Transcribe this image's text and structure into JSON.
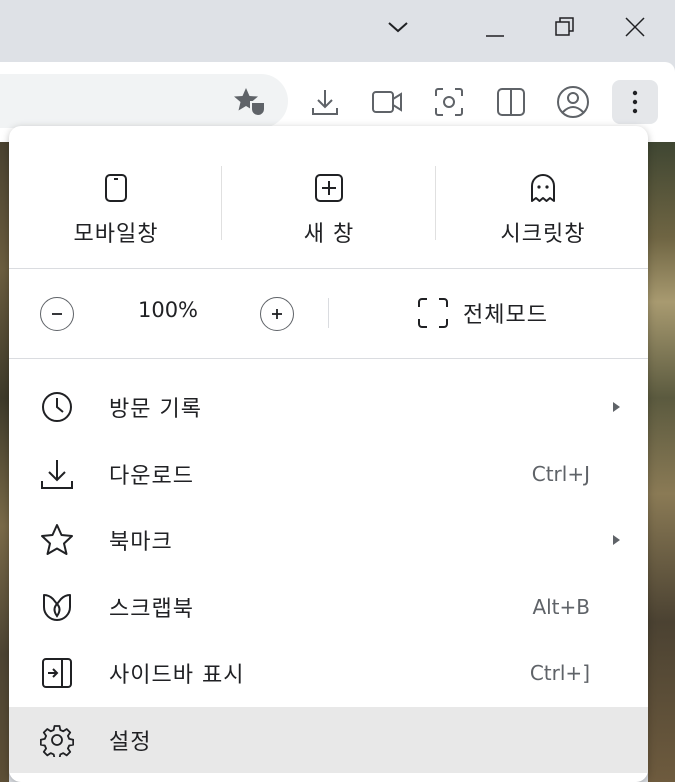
{
  "window": {
    "controls": [
      "tab-search",
      "minimize",
      "restore",
      "close"
    ]
  },
  "toolbar": {
    "icons": [
      "bookmark-star-icon",
      "download-icon",
      "screen-record-icon",
      "screenshot-icon",
      "split-view-icon",
      "profile-icon",
      "more-menu-icon"
    ]
  },
  "menu": {
    "actions": [
      {
        "label": "모바일창",
        "icon": "mobile-window-icon"
      },
      {
        "label": "새 창",
        "icon": "new-window-icon"
      },
      {
        "label": "시크릿창",
        "icon": "incognito-icon"
      }
    ],
    "zoom": {
      "value": "100%",
      "fullscreen_label": "전체모드"
    },
    "items": [
      {
        "label": "방문 기록",
        "shortcut": "",
        "submenu": true,
        "icon": "history-icon"
      },
      {
        "label": "다운로드",
        "shortcut": "Ctrl+J",
        "submenu": false,
        "icon": "download-icon"
      },
      {
        "label": "북마크",
        "shortcut": "",
        "submenu": true,
        "icon": "star-icon"
      },
      {
        "label": "스크랩북",
        "shortcut": "Alt+B",
        "submenu": false,
        "icon": "scrapbook-icon"
      },
      {
        "label": "사이드바 표시",
        "shortcut": "Ctrl+]",
        "submenu": false,
        "icon": "sidebar-icon"
      },
      {
        "label": "설정",
        "shortcut": "",
        "submenu": false,
        "icon": "gear-icon"
      }
    ]
  }
}
